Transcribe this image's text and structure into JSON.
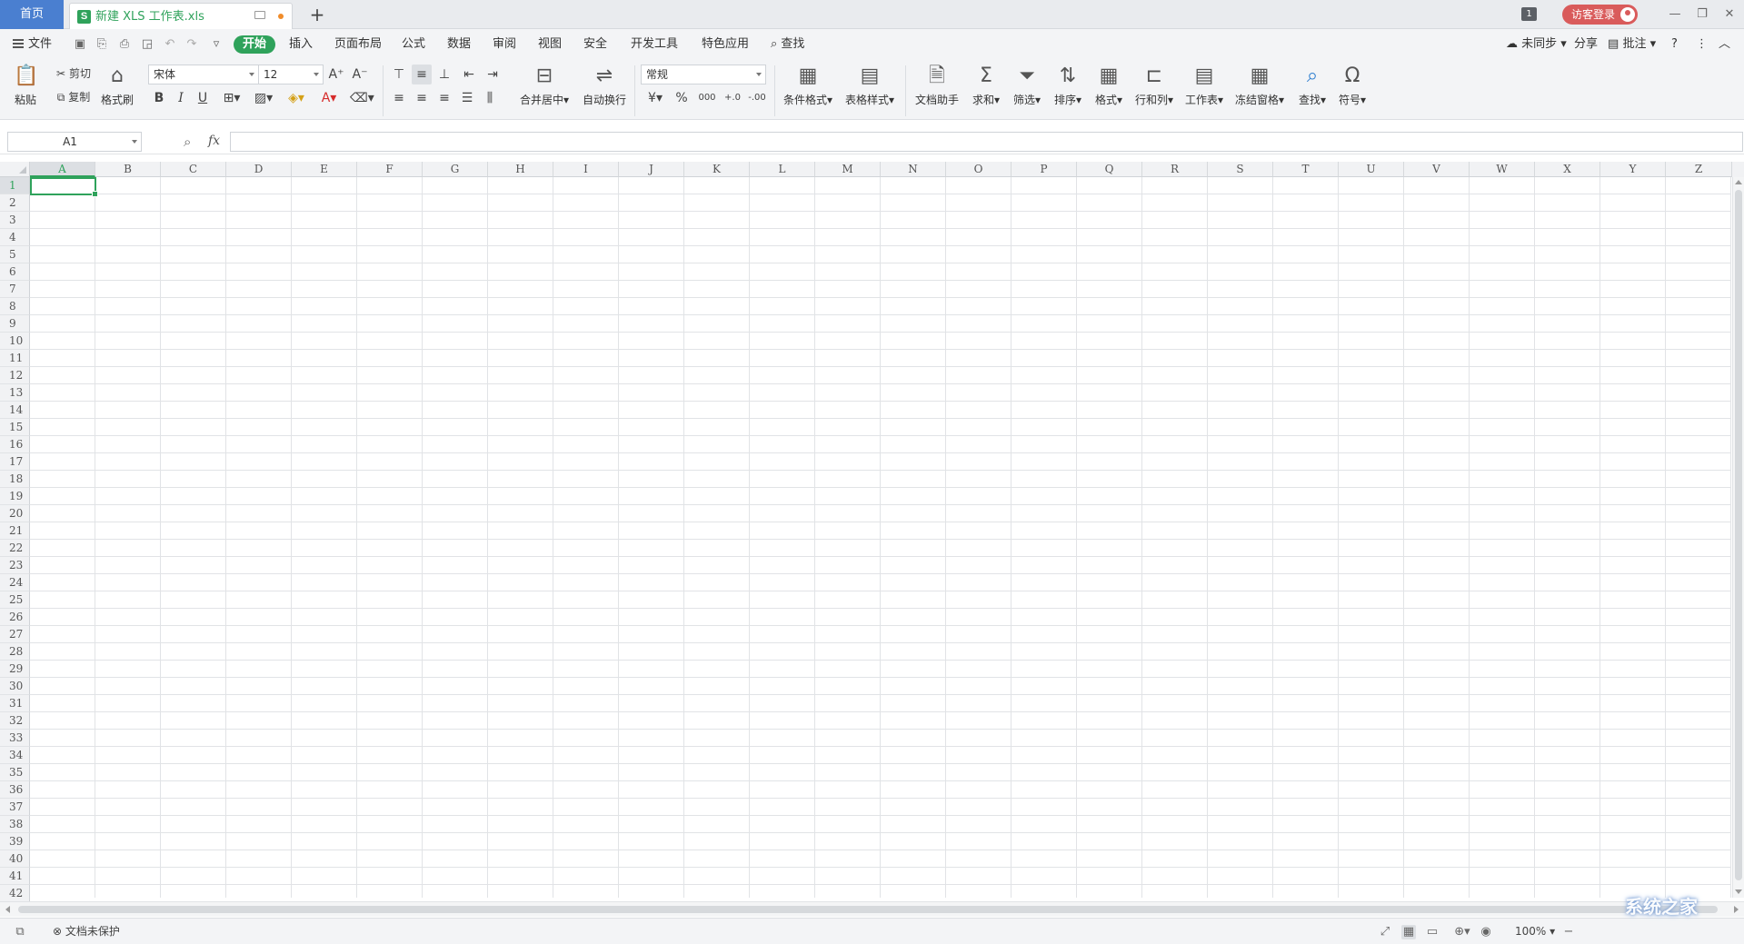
{
  "titlebar": {
    "home_tab": "首页",
    "doc_icon_letter": "S",
    "doc_tab": "新建 XLS 工作表.xls",
    "new_tab": "+",
    "window_count": "1",
    "login_label": "访客登录",
    "controls": [
      "—",
      "❐",
      "✕"
    ]
  },
  "menubar": {
    "file": "文件",
    "tabs": [
      "开始",
      "插入",
      "页面布局",
      "公式",
      "数据",
      "审阅",
      "视图",
      "安全",
      "开发工具",
      "特色应用"
    ],
    "search": "查找",
    "sync": "未同步",
    "share": "分享",
    "comment": "批注",
    "help": "?"
  },
  "ribbon": {
    "paste": "粘贴",
    "cut": "剪切",
    "copy": "复制",
    "format_painter": "格式刷",
    "font_name": "宋体",
    "font_size": "12",
    "bold": "B",
    "italic": "I",
    "underline": "U",
    "merge_center": "合并居中",
    "wrap_text": "自动换行",
    "number_format": "常规",
    "percent": "%",
    "thousands": "000",
    "inc_decimal": "+.0",
    "dec_decimal": "-.00",
    "cond_format": "条件格式",
    "table_style": "表格样式",
    "doc_helper": "文档助手",
    "sum": "求和",
    "filter": "筛选",
    "sort": "排序",
    "format": "格式",
    "row_col": "行和列",
    "worksheet": "工作表",
    "freeze": "冻结窗格",
    "find": "查找",
    "symbol": "符号"
  },
  "formula_bar": {
    "name_box": "A1",
    "fx": "fx",
    "formula": ""
  },
  "grid": {
    "columns": [
      "A",
      "B",
      "C",
      "D",
      "E",
      "F",
      "G",
      "H",
      "I",
      "J",
      "K",
      "L",
      "M",
      "N",
      "O",
      "P",
      "Q",
      "R",
      "S",
      "T",
      "U",
      "V",
      "W",
      "X",
      "Y",
      "Z"
    ],
    "rows": [
      "1",
      "2",
      "3",
      "4",
      "5",
      "6",
      "7",
      "8",
      "9",
      "10",
      "11",
      "12",
      "13",
      "14",
      "15",
      "16",
      "17",
      "18",
      "19",
      "20",
      "21",
      "22",
      "23",
      "24",
      "25",
      "26",
      "27",
      "28",
      "29",
      "30",
      "31",
      "32",
      "33",
      "34",
      "35",
      "36",
      "37",
      "38",
      "39",
      "40",
      "41",
      "42"
    ],
    "selected_cell": "A1"
  },
  "statusbar": {
    "protect": "文档未保护",
    "zoom": "100%"
  },
  "watermark": "系统之家",
  "colors": {
    "accent": "#2fa25b",
    "home_tab": "#4a7fd0",
    "login": "#d95b5b"
  }
}
